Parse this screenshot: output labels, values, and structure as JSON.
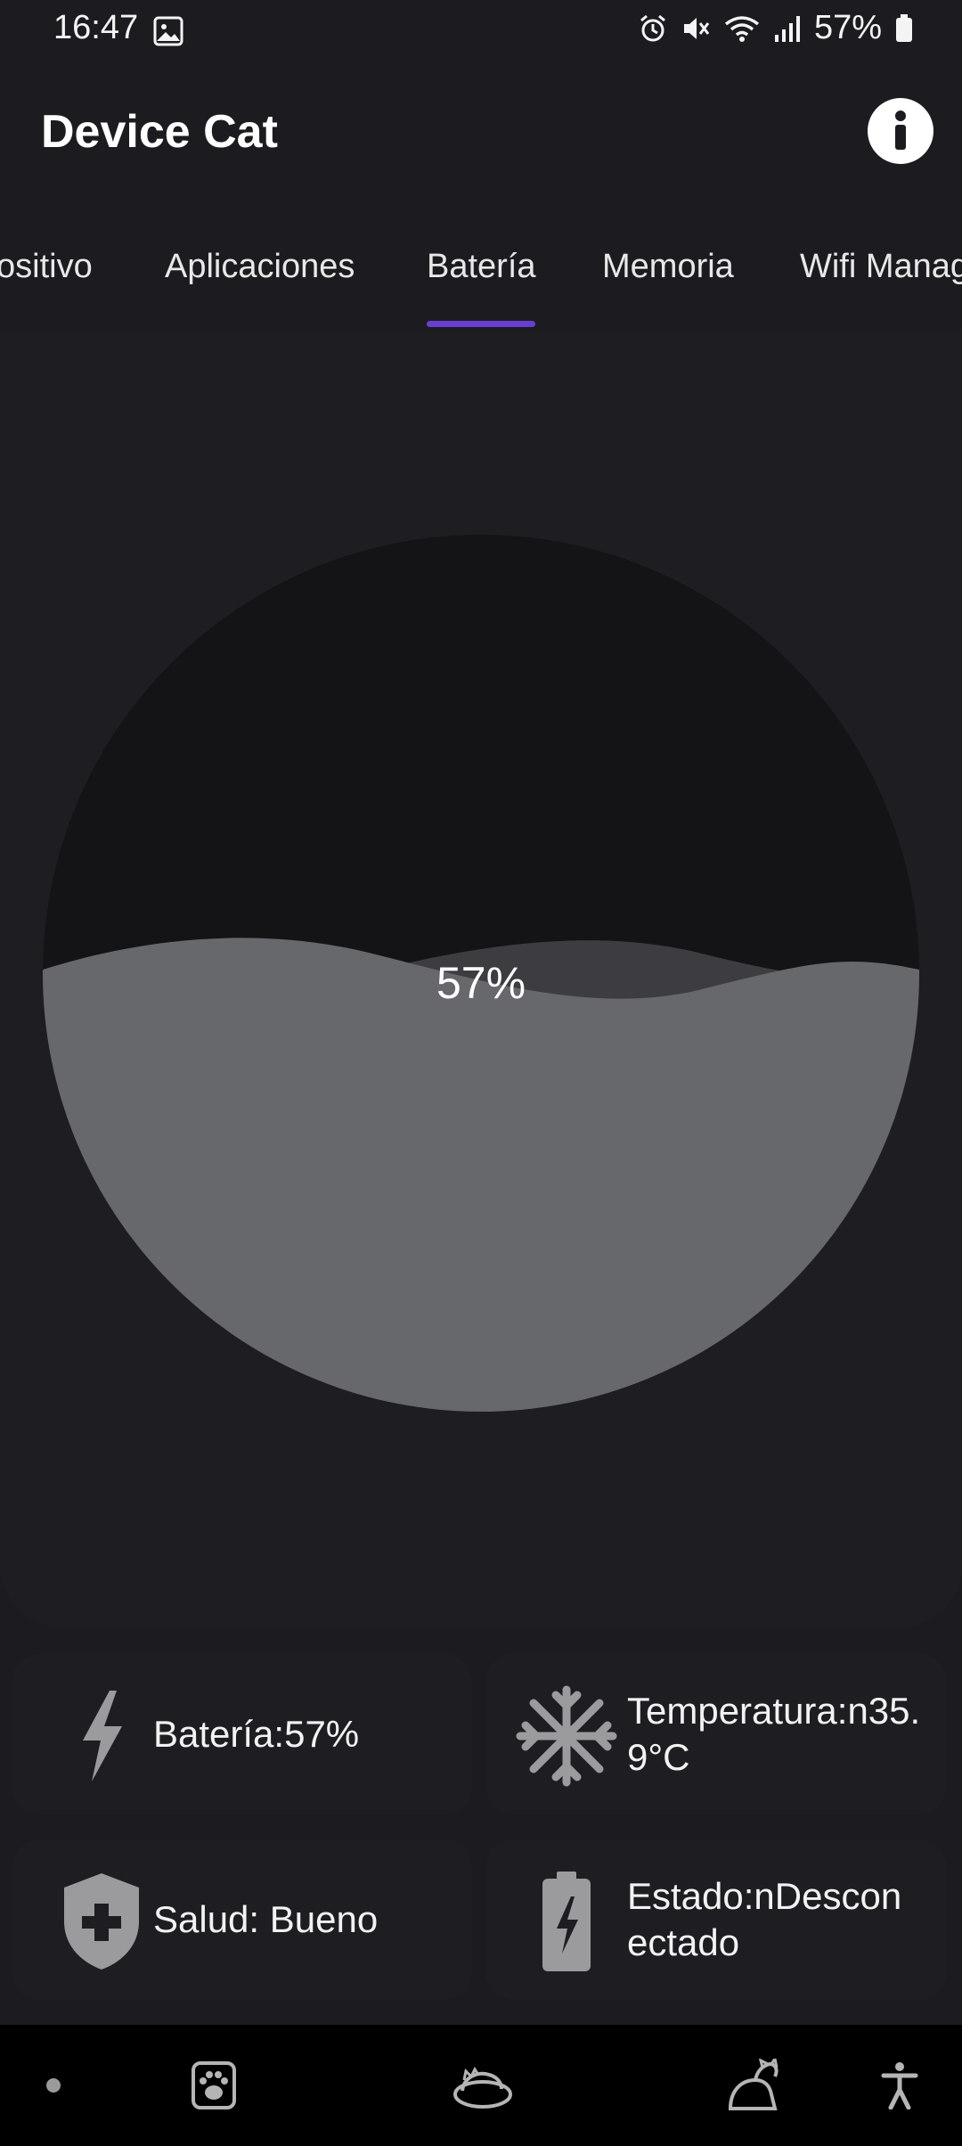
{
  "status_bar": {
    "time": "16:47",
    "battery_percent": "57%",
    "icons": [
      "gallery-icon",
      "alarm-icon",
      "mute-icon",
      "wifi-icon",
      "signal-icon",
      "battery-icon"
    ]
  },
  "app": {
    "title": "Device Cat",
    "info_icon": "info-icon"
  },
  "tabs": [
    {
      "label": "ositivo",
      "selected": false
    },
    {
      "label": "Aplicaciones",
      "selected": false
    },
    {
      "label": "Batería",
      "selected": true
    },
    {
      "label": "Memoria",
      "selected": false
    },
    {
      "label": "Wifi Manag",
      "selected": false
    }
  ],
  "gauge": {
    "label": "57%",
    "level": 0.57
  },
  "cards": [
    {
      "icon": "lightning-icon",
      "text": "Batería:57%"
    },
    {
      "icon": "snowflake-icon",
      "text": "Temperatura:n35.9°C"
    },
    {
      "icon": "health-shield-icon",
      "text": "Salud: Bueno"
    },
    {
      "icon": "battery-charging-icon",
      "text": "Estado:nDesconectado"
    }
  ],
  "colors": {
    "background": "#1c1c20",
    "tab_indicator": "#6a3fd0",
    "gauge_fill": "#67686c",
    "gauge_back": "#141417",
    "icon_gray": "#9b9b9e"
  },
  "nav": [
    "dot-icon",
    "paw-icon",
    "sleeping-cat-icon",
    "cat-icon",
    "accessibility-icon"
  ]
}
